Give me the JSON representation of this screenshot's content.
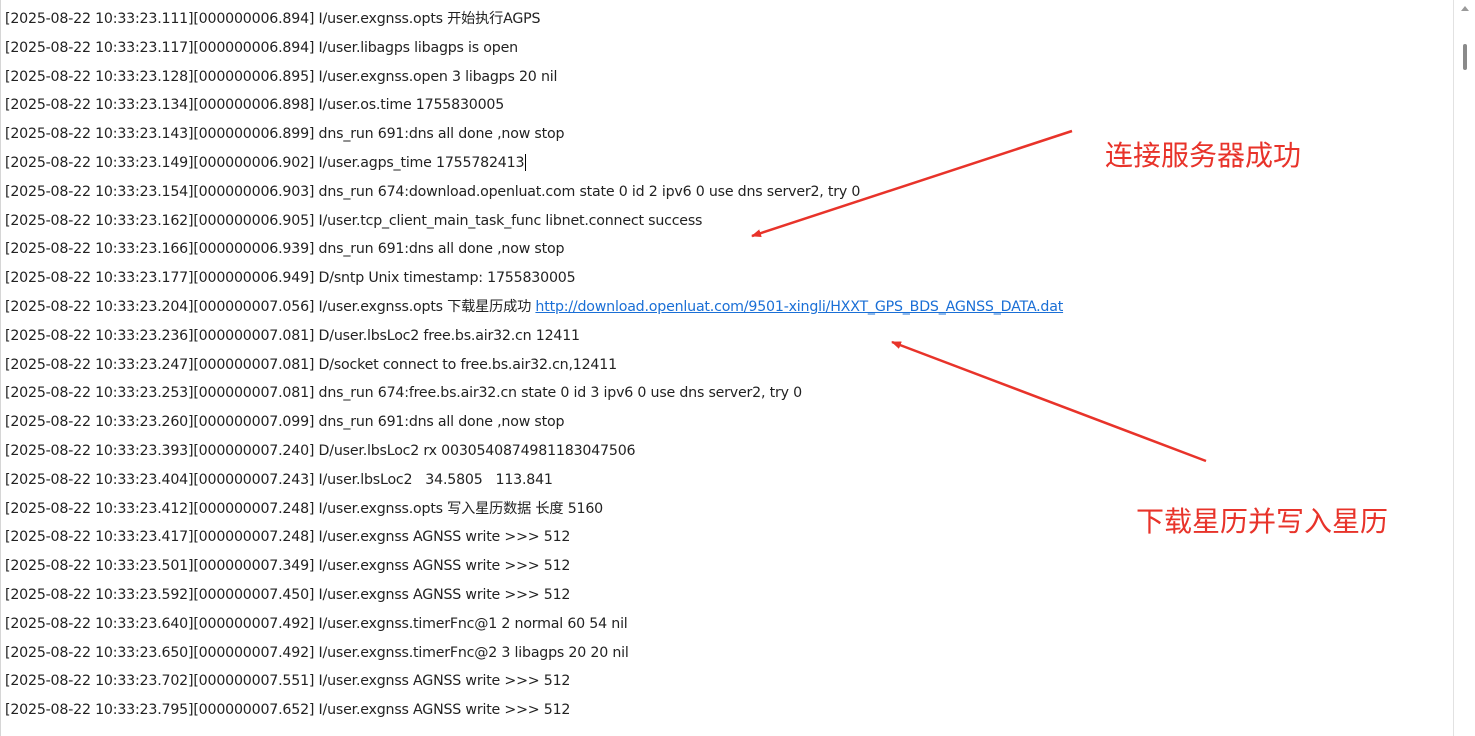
{
  "log": {
    "lines": [
      "[2025-08-22 10:33:23.111][000000006.894] I/user.exgnss.opts 开始执行AGPS",
      "[2025-08-22 10:33:23.117][000000006.894] I/user.libagps libagps is open",
      "[2025-08-22 10:33:23.128][000000006.895] I/user.exgnss.open 3 libagps 20 nil",
      "[2025-08-22 10:33:23.134][000000006.898] I/user.os.time 1755830005",
      "[2025-08-22 10:33:23.143][000000006.899] dns_run 691:dns all done ,now stop",
      "[2025-08-22 10:33:23.149][000000006.902] I/user.agps_time 1755782413",
      "[2025-08-22 10:33:23.154][000000006.903] dns_run 674:download.openluat.com state 0 id 2 ipv6 0 use dns server2, try 0",
      "[2025-08-22 10:33:23.162][000000006.905] I/user.tcp_client_main_task_func libnet.connect success",
      "[2025-08-22 10:33:23.166][000000006.939] dns_run 691:dns all done ,now stop",
      "[2025-08-22 10:33:23.177][000000006.949] D/sntp Unix timestamp: 1755830005",
      "[2025-08-22 10:33:23.204][000000007.056] I/user.exgnss.opts 下载星历成功 ",
      "[2025-08-22 10:33:23.236][000000007.081] D/user.lbsLoc2 free.bs.air32.cn 12411",
      "[2025-08-22 10:33:23.247][000000007.081] D/socket connect to free.bs.air32.cn,12411",
      "[2025-08-22 10:33:23.253][000000007.081] dns_run 674:free.bs.air32.cn state 0 id 3 ipv6 0 use dns server2, try 0",
      "[2025-08-22 10:33:23.260][000000007.099] dns_run 691:dns all done ,now stop",
      "[2025-08-22 10:33:23.393][000000007.240] D/user.lbsLoc2 rx 003054087498118304750​6",
      "[2025-08-22 10:33:23.404][000000007.243] I/user.lbsLoc2   34.5805   113.841",
      "[2025-08-22 10:33:23.412][000000007.248] I/user.exgnss.opts 写入星历数据 长度 5160",
      "[2025-08-22 10:33:23.417][000000007.248] I/user.exgnss AGNSS write >>> 512",
      "[2025-08-22 10:33:23.501][000000007.349] I/user.exgnss AGNSS write >>> 512",
      "[2025-08-22 10:33:23.592][000000007.450] I/user.exgnss AGNSS write >>> 512",
      "[2025-08-22 10:33:23.640][000000007.492] I/user.exgnss.timerFnc@1 2 normal 60 54 nil",
      "[2025-08-22 10:33:23.650][000000007.492] I/user.exgnss.timerFnc@2 3 libagps 20 20 nil",
      "[2025-08-22 10:33:23.702][000000007.551] I/user.exgnss AGNSS write >>> 512",
      "[2025-08-22 10:33:23.795][000000007.652] I/user.exgnss AGNSS write >>> 512"
    ],
    "link_line_index": 10,
    "link_text": "http://download.openluat.com/9501-xingli/HXXT_GPS_BDS_AGNSS_DATA.dat",
    "caret_line_index": 5
  },
  "annotations": {
    "connect_success": "连接服务器成功",
    "download_write": "下载星历并写入星历",
    "color": "#e8332a"
  },
  "scrollbar": {
    "icon": "scroll-up-arrow-icon"
  }
}
